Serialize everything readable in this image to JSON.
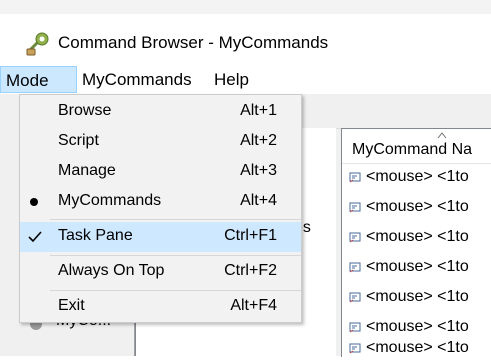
{
  "window": {
    "title": "Command Browser - MyCommands"
  },
  "menubar": {
    "items": [
      {
        "label": "Mode"
      },
      {
        "label": "MyCommands"
      },
      {
        "label": "Help"
      }
    ]
  },
  "mode_menu": {
    "items": [
      {
        "label": "Browse",
        "shortcut": "Alt+1",
        "state": "none"
      },
      {
        "label": "Script",
        "shortcut": "Alt+2",
        "state": "none"
      },
      {
        "label": "Manage",
        "shortcut": "Alt+3",
        "state": "none"
      },
      {
        "label": "MyCommands",
        "shortcut": "Alt+4",
        "state": "radio-selected"
      },
      {
        "label": "Task Pane",
        "shortcut": "Ctrl+F1",
        "state": "checked"
      },
      {
        "label": "Always On Top",
        "shortcut": "Ctrl+F2",
        "state": "none"
      },
      {
        "label": "Exit",
        "shortcut": "Alt+F4",
        "state": "none"
      }
    ]
  },
  "left_pane": {
    "partial_text": "es",
    "bottom_label": "MyCo..."
  },
  "grid": {
    "column_header": "MyCommand Na",
    "rows": [
      {
        "text": "<mouse> <1to"
      },
      {
        "text": "<mouse> <1to"
      },
      {
        "text": "<mouse> <1to"
      },
      {
        "text": "<mouse> <1to"
      },
      {
        "text": "<mouse> <1to"
      },
      {
        "text": "<mouse> <1to"
      },
      {
        "text": "<mouse> <1to"
      }
    ]
  },
  "colors": {
    "menu_open_bg": "#cce8ff",
    "menu_highlight_bg": "#cde8ff",
    "dropdown_bg": "#f2f2f2"
  }
}
